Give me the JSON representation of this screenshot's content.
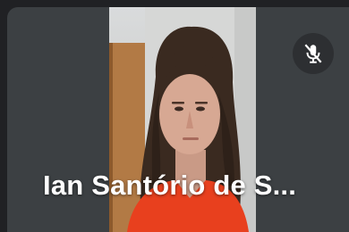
{
  "participant": {
    "name": "Ian Santório de S...",
    "mic_state": "muted"
  },
  "icons": {
    "mic": "mic-off-icon"
  },
  "colors": {
    "background": "#202124",
    "tile": "#3c4043",
    "label": "#ffffff"
  }
}
